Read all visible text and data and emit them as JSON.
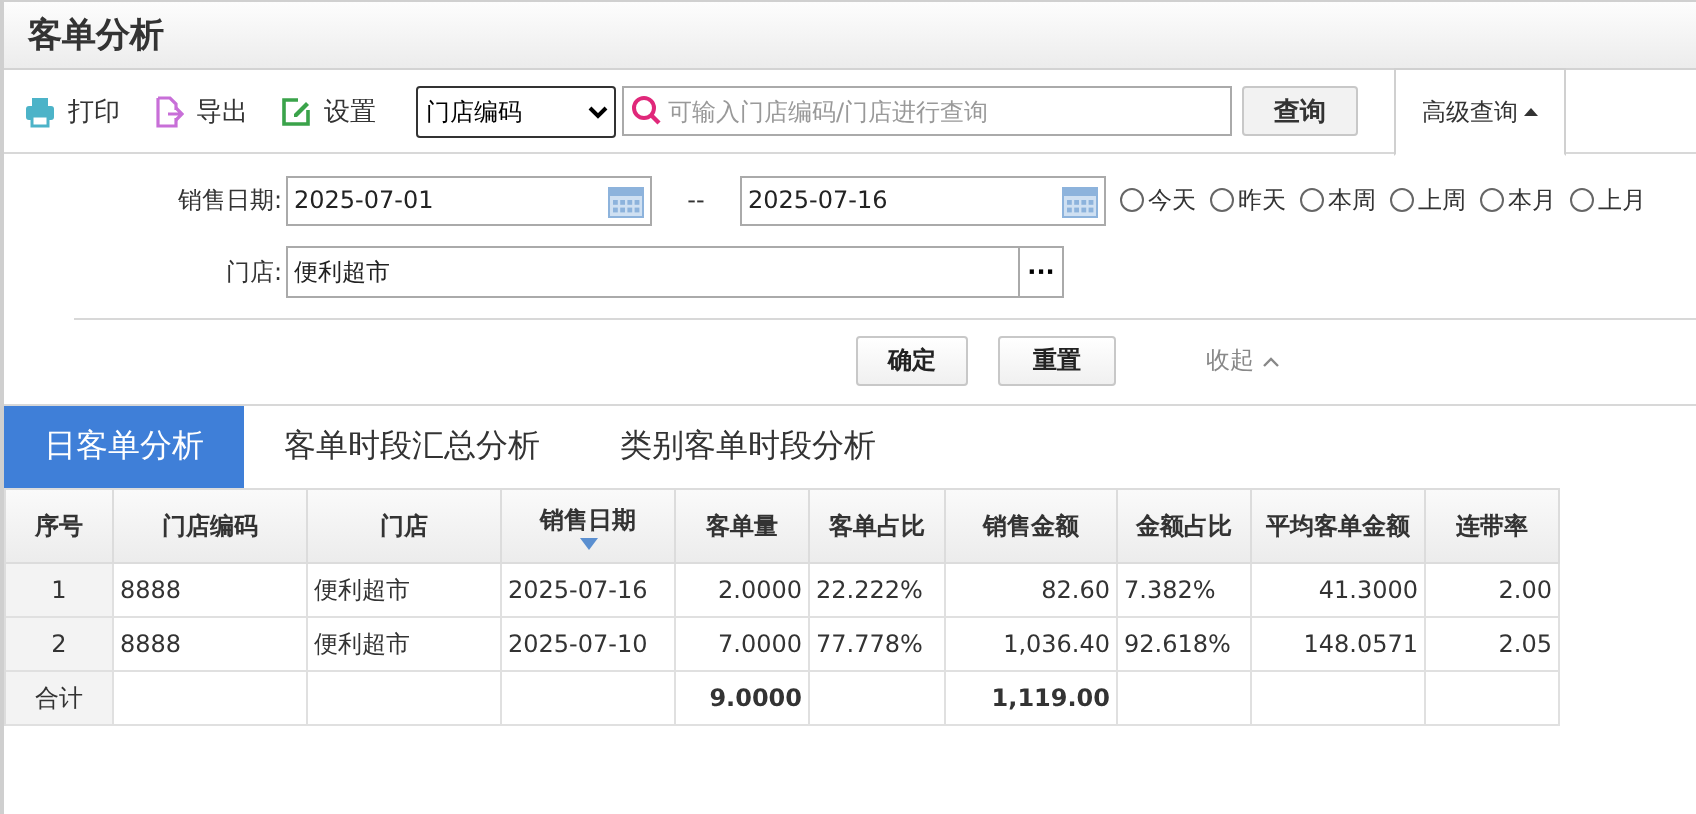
{
  "page_title": "客单分析",
  "toolbar": {
    "actions": [
      {
        "label": "打印",
        "kind": "print"
      },
      {
        "label": "导出",
        "kind": "export"
      },
      {
        "label": "设置",
        "kind": "settings"
      }
    ],
    "field_select": {
      "value": "门店编码"
    },
    "search": {
      "placeholder": "可输入门店编码/门店进行查询"
    },
    "search_button": "查询",
    "advanced_toggle": {
      "label": "高级查询",
      "expanded": true
    }
  },
  "filters": {
    "date_label": "销售日期:",
    "date_from": "2025-07-01",
    "date_separator": "--",
    "date_to": "2025-07-16",
    "quick_ranges": [
      {
        "label": "今天",
        "selected": false
      },
      {
        "label": "昨天",
        "selected": false
      },
      {
        "label": "本周",
        "selected": false
      },
      {
        "label": "上周",
        "selected": false
      },
      {
        "label": "本月",
        "selected": false
      },
      {
        "label": "上月",
        "selected": false
      }
    ],
    "store_label": "门店:",
    "store_value": "便利超市",
    "store_picker": "···",
    "confirm_button": "确定",
    "reset_button": "重置",
    "collapse_link": "收起"
  },
  "tabs": [
    {
      "label": "日客单分析",
      "selected": true
    },
    {
      "label": "客单时段汇总分析",
      "selected": false
    },
    {
      "label": "类别客单时段分析",
      "selected": false
    }
  ],
  "table": {
    "columns": [
      {
        "label": "序号",
        "sorted": false
      },
      {
        "label": "门店编码",
        "sorted": false
      },
      {
        "label": "门店",
        "sorted": false
      },
      {
        "label": "销售日期",
        "sorted": true
      },
      {
        "label": "客单量",
        "sorted": false
      },
      {
        "label": "客单占比",
        "sorted": false
      },
      {
        "label": "销售金额",
        "sorted": false
      },
      {
        "label": "金额占比",
        "sorted": false
      },
      {
        "label": "平均客单金额",
        "sorted": false
      },
      {
        "label": "连带率",
        "sorted": false
      }
    ],
    "rows": [
      [
        "1",
        "8888",
        "便利超市",
        "2025-07-16",
        "2.0000",
        "22.222%",
        "82.60",
        "7.382%",
        "41.3000",
        "2.00"
      ],
      [
        "2",
        "8888",
        "便利超市",
        "2025-07-10",
        "7.0000",
        "77.778%",
        "1,036.40",
        "92.618%",
        "148.0571",
        "2.05"
      ]
    ],
    "total_row": {
      "label": "合计",
      "customer_count": "9.0000",
      "sales_amount": "1,119.00"
    }
  }
}
